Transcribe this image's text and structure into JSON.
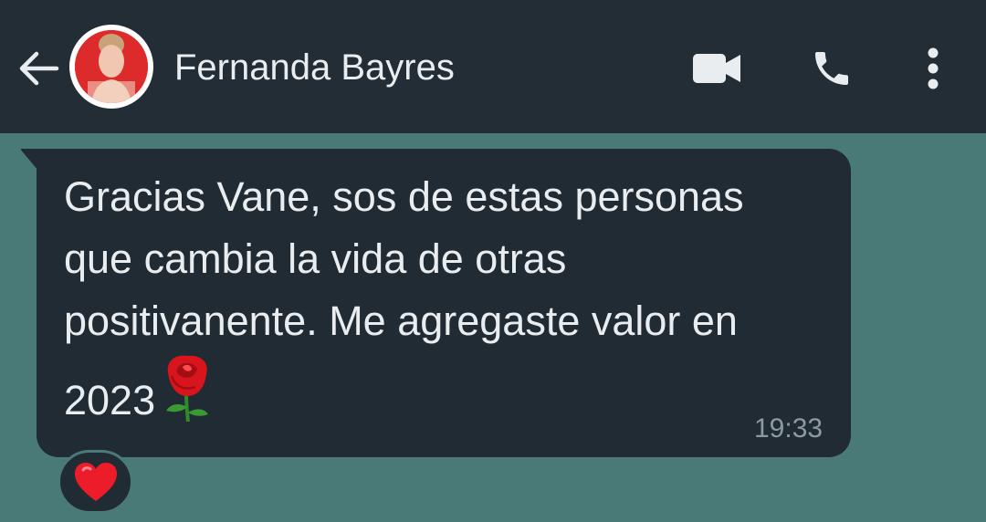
{
  "header": {
    "contact_name": "Fernanda Bayres",
    "back_icon": "arrow-left-icon",
    "video_icon": "video-camera-icon",
    "call_icon": "phone-icon",
    "menu_icon": "more-vertical-icon",
    "bg_color": "#222d35"
  },
  "chat": {
    "background_color": "#4a7a78",
    "messages": [
      {
        "direction": "incoming",
        "text": "Gracias Vane, sos de estas personas que cambia la vida de otras positivanente. Me agregaste valor en 2023",
        "emoji": "rose",
        "time": "19:33",
        "reaction": "red-heart",
        "bubble_color": "#212b33"
      }
    ]
  }
}
